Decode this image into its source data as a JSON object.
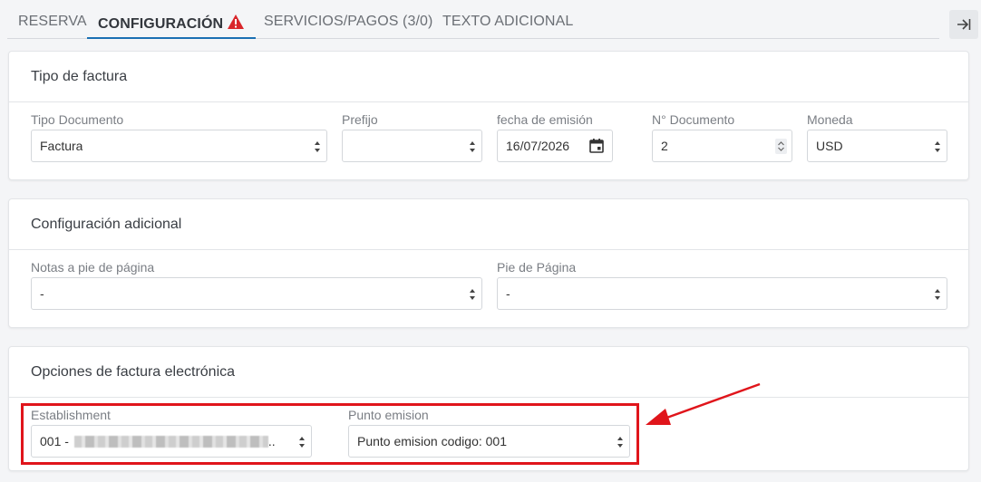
{
  "tabs": [
    {
      "label": "RESERVA"
    },
    {
      "label": "CONFIGURACIÓN"
    },
    {
      "label": "SERVICIOS/PAGOS (3/0)"
    },
    {
      "label": "TEXTO ADICIONAL"
    }
  ],
  "tab_warning_icon": "warning-triangle-icon",
  "collapse_icon": "collapse-right-icon",
  "invoice_type": {
    "title": "Tipo de factura",
    "doc_type": {
      "label": "Tipo Documento",
      "value": "Factura"
    },
    "prefix": {
      "label": "Prefijo",
      "value": ""
    },
    "issue_date": {
      "label": "fecha de emisión",
      "value": "16/07/2026"
    },
    "doc_number": {
      "label": "N° Documento",
      "value": "2"
    },
    "currency": {
      "label": "Moneda",
      "value": "USD"
    }
  },
  "additional_config": {
    "title": "Configuración adicional",
    "footnotes": {
      "label": "Notas a pie de página",
      "value": "-"
    },
    "footer": {
      "label": "Pie de Página",
      "value": "-"
    }
  },
  "einvoice": {
    "title": "Opciones de factura electrónica",
    "establishment": {
      "label": "Establishment",
      "value": "001 -",
      "suffix": ".."
    },
    "emission_point": {
      "label": "Punto emision",
      "value": "Punto emision codigo: 001"
    }
  },
  "colors": {
    "accent": "#1a6fb3",
    "highlight": "#e0151b",
    "warning": "#d9262b"
  }
}
